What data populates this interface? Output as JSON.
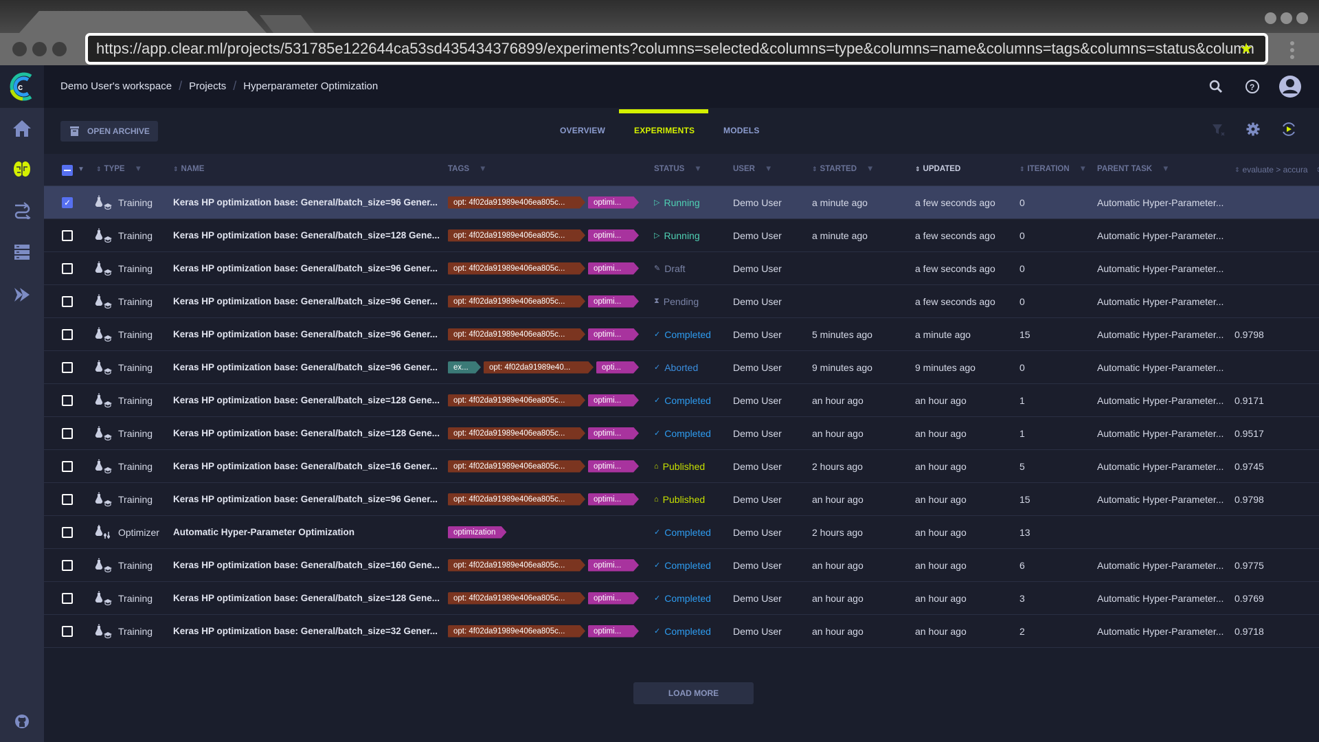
{
  "browser": {
    "url": "https://app.clear.ml/projects/531785e122644ca53sd435434376899/experiments?columns=selected&columns=type&columns=name&columns=tags&columns=status&column",
    "bookmark_icon": "star-icon"
  },
  "header": {
    "breadcrumb": [
      "Demo User's workspace",
      "Projects",
      "Hyperparameter Optimization"
    ]
  },
  "sidebar": {
    "items": [
      {
        "name": "home",
        "icon": "home-icon"
      },
      {
        "name": "experiments",
        "icon": "brain-icon",
        "active": true
      },
      {
        "name": "pipelines",
        "icon": "pipeline-icon"
      },
      {
        "name": "datasets",
        "icon": "server-icon"
      },
      {
        "name": "orchestration",
        "icon": "forward-icon"
      }
    ],
    "footer_icon": "github-icon"
  },
  "toolbar": {
    "archive_label": "OPEN ARCHIVE",
    "tabs": [
      "OVERVIEW",
      "EXPERIMENTS",
      "MODELS"
    ],
    "active_tab": "EXPERIMENTS"
  },
  "table": {
    "columns": {
      "type": "TYPE",
      "name": "NAME",
      "tags": "TAGS",
      "status": "STATUS",
      "user": "USER",
      "started": "STARTED",
      "updated": "UPDATED",
      "iteration": "ITERATION",
      "parent": "PARENT TASK",
      "metric": "evaluate > accura"
    },
    "rows": [
      {
        "selected": true,
        "type": "Training",
        "name": "Keras HP optimization base: General/batch_size=96 Gener...",
        "tags": [
          {
            "text": "opt: 4f02da91989e406ea805c...",
            "kind": "opt"
          },
          {
            "text": "optimi...",
            "kind": "optim"
          }
        ],
        "status": "Running",
        "user": "Demo User",
        "started": "a minute ago",
        "updated": "a few seconds ago",
        "iteration": "0",
        "parent": "Automatic Hyper-Parameter...",
        "metric": ""
      },
      {
        "selected": false,
        "type": "Training",
        "name": "Keras HP optimization base: General/batch_size=128 Gene...",
        "tags": [
          {
            "text": "opt: 4f02da91989e406ea805c...",
            "kind": "opt"
          },
          {
            "text": "optimi...",
            "kind": "optim"
          }
        ],
        "status": "Running",
        "user": "Demo User",
        "started": "a minute ago",
        "updated": "a few seconds ago",
        "iteration": "0",
        "parent": "Automatic Hyper-Parameter...",
        "metric": ""
      },
      {
        "selected": false,
        "type": "Training",
        "name": "Keras HP optimization base: General/batch_size=96 Gener...",
        "tags": [
          {
            "text": "opt: 4f02da91989e406ea805c...",
            "kind": "opt"
          },
          {
            "text": "optimi...",
            "kind": "optim"
          }
        ],
        "status": "Draft",
        "user": "Demo User",
        "started": "",
        "updated": "a few seconds ago",
        "iteration": "0",
        "parent": "Automatic Hyper-Parameter...",
        "metric": ""
      },
      {
        "selected": false,
        "type": "Training",
        "name": "Keras HP optimization base: General/batch_size=96 Gener...",
        "tags": [
          {
            "text": "opt: 4f02da91989e406ea805c...",
            "kind": "opt"
          },
          {
            "text": "optimi...",
            "kind": "optim"
          }
        ],
        "status": "Pending",
        "user": "Demo User",
        "started": "",
        "updated": "a few seconds ago",
        "iteration": "0",
        "parent": "Automatic Hyper-Parameter...",
        "metric": ""
      },
      {
        "selected": false,
        "type": "Training",
        "name": "Keras HP optimization base: General/batch_size=96 Gener...",
        "tags": [
          {
            "text": "opt: 4f02da91989e406ea805c...",
            "kind": "opt"
          },
          {
            "text": "optimi...",
            "kind": "optim"
          }
        ],
        "status": "Completed",
        "user": "Demo User",
        "started": "5 minutes ago",
        "updated": "a minute ago",
        "iteration": "15",
        "parent": "Automatic Hyper-Parameter...",
        "metric": "0.9798"
      },
      {
        "selected": false,
        "type": "Training",
        "name": "Keras HP optimization base: General/batch_size=96 Gener...",
        "tags": [
          {
            "text": "ex...",
            "kind": "ex"
          },
          {
            "text": "opt: 4f02da91989e40...",
            "kind": "opt"
          },
          {
            "text": "opti...",
            "kind": "optim"
          }
        ],
        "status": "Aborted",
        "user": "Demo User",
        "started": "9 minutes ago",
        "updated": "9 minutes ago",
        "iteration": "0",
        "parent": "Automatic Hyper-Parameter...",
        "metric": ""
      },
      {
        "selected": false,
        "type": "Training",
        "name": "Keras HP optimization base: General/batch_size=128 Gene...",
        "tags": [
          {
            "text": "opt: 4f02da91989e406ea805c...",
            "kind": "opt"
          },
          {
            "text": "optimi...",
            "kind": "optim"
          }
        ],
        "status": "Completed",
        "user": "Demo User",
        "started": "an hour ago",
        "updated": "an hour ago",
        "iteration": "1",
        "parent": "Automatic Hyper-Parameter...",
        "metric": "0.9171"
      },
      {
        "selected": false,
        "type": "Training",
        "name": "Keras HP optimization base: General/batch_size=128 Gene...",
        "tags": [
          {
            "text": "opt: 4f02da91989e406ea805c...",
            "kind": "opt"
          },
          {
            "text": "optimi...",
            "kind": "optim"
          }
        ],
        "status": "Completed",
        "user": "Demo User",
        "started": "an hour ago",
        "updated": "an hour ago",
        "iteration": "1",
        "parent": "Automatic Hyper-Parameter...",
        "metric": "0.9517"
      },
      {
        "selected": false,
        "type": "Training",
        "name": "Keras HP optimization base: General/batch_size=16 Gener...",
        "tags": [
          {
            "text": "opt: 4f02da91989e406ea805c...",
            "kind": "opt"
          },
          {
            "text": "optimi...",
            "kind": "optim"
          }
        ],
        "status": "Published",
        "user": "Demo User",
        "started": "2 hours ago",
        "updated": "an hour ago",
        "iteration": "5",
        "parent": "Automatic Hyper-Parameter...",
        "metric": "0.9745"
      },
      {
        "selected": false,
        "type": "Training",
        "name": "Keras HP optimization base: General/batch_size=96 Gener...",
        "tags": [
          {
            "text": "opt: 4f02da91989e406ea805c...",
            "kind": "opt"
          },
          {
            "text": "optimi...",
            "kind": "optim"
          }
        ],
        "status": "Published",
        "user": "Demo User",
        "started": "an hour ago",
        "updated": "an hour ago",
        "iteration": "15",
        "parent": "Automatic Hyper-Parameter...",
        "metric": "0.9798"
      },
      {
        "selected": false,
        "type": "Optimizer",
        "name": "Automatic Hyper-Parameter Optimization",
        "tags": [
          {
            "text": "optimization",
            "kind": "optim"
          }
        ],
        "status": "Completed",
        "user": "Demo User",
        "started": "2 hours ago",
        "updated": "an hour ago",
        "iteration": "13",
        "parent": "",
        "metric": ""
      },
      {
        "selected": false,
        "type": "Training",
        "name": "Keras HP optimization base: General/batch_size=160 Gene...",
        "tags": [
          {
            "text": "opt: 4f02da91989e406ea805c...",
            "kind": "opt"
          },
          {
            "text": "optimi...",
            "kind": "optim"
          }
        ],
        "status": "Completed",
        "user": "Demo User",
        "started": "an hour ago",
        "updated": "an hour ago",
        "iteration": "6",
        "parent": "Automatic Hyper-Parameter...",
        "metric": "0.9775"
      },
      {
        "selected": false,
        "type": "Training",
        "name": "Keras HP optimization base: General/batch_size=128 Gene...",
        "tags": [
          {
            "text": "opt: 4f02da91989e406ea805c...",
            "kind": "opt"
          },
          {
            "text": "optimi...",
            "kind": "optim"
          }
        ],
        "status": "Completed",
        "user": "Demo User",
        "started": "an hour ago",
        "updated": "an hour ago",
        "iteration": "3",
        "parent": "Automatic Hyper-Parameter...",
        "metric": "0.9769"
      },
      {
        "selected": false,
        "type": "Training",
        "name": "Keras HP optimization base: General/batch_size=32 Gener...",
        "tags": [
          {
            "text": "opt: 4f02da91989e406ea805c...",
            "kind": "opt"
          },
          {
            "text": "optimi...",
            "kind": "optim"
          }
        ],
        "status": "Completed",
        "user": "Demo User",
        "started": "an hour ago",
        "updated": "an hour ago",
        "iteration": "2",
        "parent": "Automatic Hyper-Parameter...",
        "metric": "0.9718"
      }
    ]
  },
  "status_styles": {
    "Running": {
      "color": "#4fd1b4",
      "icon": "▷",
      "icon_name": "play-icon"
    },
    "Draft": {
      "color": "#7a83a6",
      "icon": "✎",
      "icon_name": "pencil-icon"
    },
    "Pending": {
      "color": "#7a83a6",
      "icon": "⧗",
      "icon_name": "hourglass-icon"
    },
    "Completed": {
      "color": "#2e9cf0",
      "icon": "✓",
      "icon_name": "check-icon"
    },
    "Aborted": {
      "color": "#3b8fe0",
      "icon": "✓",
      "icon_name": "check-icon"
    },
    "Published": {
      "color": "#c6e000",
      "icon": "⌂",
      "icon_name": "published-icon"
    }
  },
  "tag_colors": {
    "opt": "#7b3520",
    "optim": "#a8339e",
    "ex": "#3b7a77"
  },
  "colors": {
    "accent": "#d4f000",
    "selection": "#5670f0"
  },
  "footer": {
    "load_more_label": "LOAD MORE"
  }
}
